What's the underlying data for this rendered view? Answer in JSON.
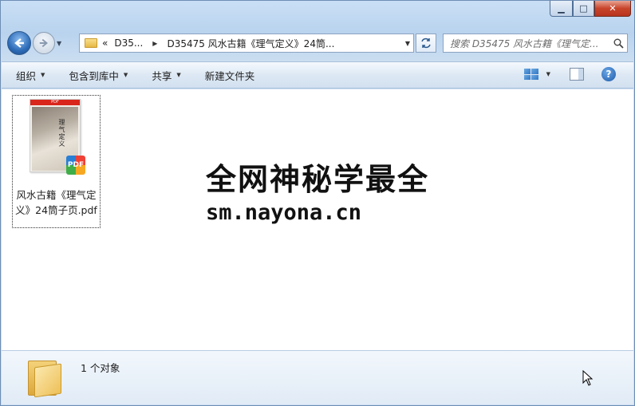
{
  "window": {
    "minimize": "▁",
    "maximize": "□",
    "close": "✕"
  },
  "nav": {
    "back_icon": "back-arrow-icon",
    "forward_icon": "forward-arrow-icon",
    "breadcrumb_overflow": "«",
    "breadcrumb_parent": "D35...",
    "breadcrumb_current": "D35475 风水古籍《理气定义》24筒...",
    "search_placeholder": "搜索 D35475 风水古籍《理气定..."
  },
  "toolbar": {
    "organize": "组织",
    "include_library": "包含到库中",
    "share": "共享",
    "new_folder": "新建文件夹"
  },
  "files": [
    {
      "name": "风水古籍《理气定义》24筒子页.pdf",
      "thumb_band": "PDF",
      "thumb_text": "理气定义",
      "badge": "PDF"
    }
  ],
  "watermark": {
    "line1": "全网神秘学最全",
    "line2": "sm.nayona.cn"
  },
  "status": {
    "count": "1 个对象"
  }
}
